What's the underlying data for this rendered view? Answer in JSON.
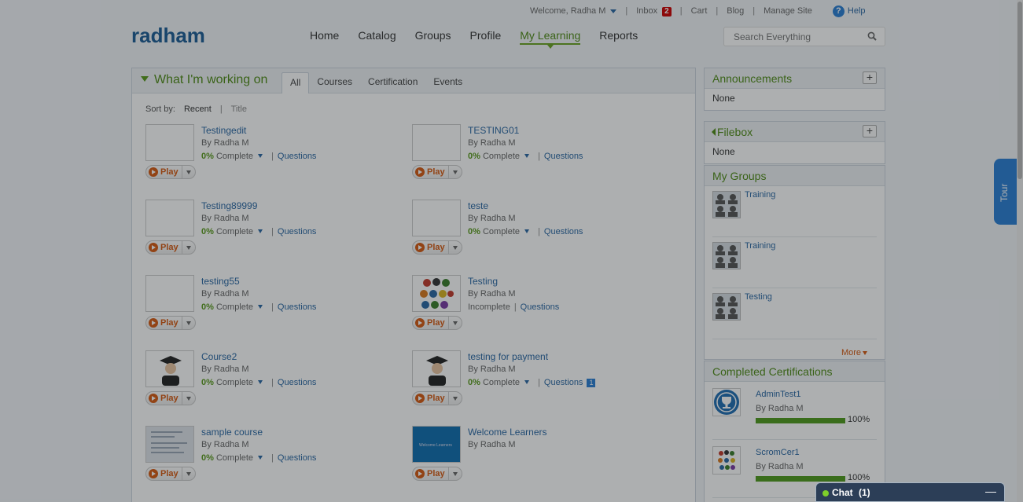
{
  "utilbar": {
    "welcome": "Welcome, Radha M",
    "inbox_label": "Inbox",
    "inbox_count": "2",
    "cart": "Cart",
    "blog": "Blog",
    "manage_site": "Manage Site",
    "help": "Help",
    "sep": "|"
  },
  "logo": "radham",
  "nav": {
    "home": "Home",
    "catalog": "Catalog",
    "groups": "Groups",
    "profile": "Profile",
    "my_learning": "My Learning",
    "reports": "Reports"
  },
  "search": {
    "placeholder": "Search Everything"
  },
  "working_on": {
    "title": "What I'm working on",
    "tabs": [
      "All",
      "Courses",
      "Certification",
      "Events"
    ],
    "active_tab": "All",
    "sort_label": "Sort by:",
    "sort_recent": "Recent",
    "sort_sep": "|",
    "sort_title": "Title"
  },
  "courses": [
    {
      "name": "Testingedit",
      "by": "By Radha M",
      "pct": "0%",
      "status": "Complete",
      "questions": "Questions",
      "play": "Play"
    },
    {
      "name": "TESTING01",
      "by": "By Radha M",
      "pct": "0%",
      "status": "Complete",
      "questions": "Questions",
      "play": "Play"
    },
    {
      "name": "Testing89999",
      "by": "By Radha M",
      "pct": "0%",
      "status": "Complete",
      "questions": "Questions",
      "play": "Play"
    },
    {
      "name": "teste",
      "by": "By Radha M",
      "pct": "0%",
      "status": "Complete",
      "questions": "Questions",
      "play": "Play"
    },
    {
      "name": "testing55",
      "by": "By Radha M",
      "pct": "0%",
      "status": "Complete",
      "questions": "Questions",
      "play": "Play"
    },
    {
      "name": "Testing",
      "by": "By Radha M",
      "pct": "",
      "status": "Incomplete",
      "questions": "Questions",
      "play": "Play"
    },
    {
      "name": "Course2",
      "by": "By Radha M",
      "pct": "0%",
      "status": "Complete",
      "questions": "Questions",
      "play": "Play"
    },
    {
      "name": "testing for payment",
      "by": "By Radha M",
      "pct": "0%",
      "status": "Complete",
      "questions": "Questions",
      "question_count": "1",
      "play": "Play"
    },
    {
      "name": "sample course",
      "by": "By Radha M",
      "pct": "0%",
      "status": "Complete",
      "questions": "Questions",
      "play": "Play"
    },
    {
      "name": "Welcome Learners",
      "by": "By Radha M",
      "play": "Play",
      "thumb_text": "Welcome Learners"
    }
  ],
  "announcements": {
    "title": "Announcements",
    "body": "None",
    "plus": "+"
  },
  "filebox": {
    "title": "Filebox",
    "body": "None",
    "plus": "+"
  },
  "my_groups": {
    "title": "My Groups",
    "items": [
      {
        "name": "Training"
      },
      {
        "name": "Training"
      },
      {
        "name": "Testing"
      }
    ],
    "more": "More"
  },
  "certifications": {
    "title": "Completed Certifications",
    "items": [
      {
        "name": "AdminTest1",
        "by": "By Radha M",
        "progress": 1.0,
        "value": "100%"
      },
      {
        "name": "ScromCer1",
        "by": "By Radha M",
        "progress": 1.0,
        "value": "100%"
      }
    ]
  },
  "tour": "Tour",
  "chat": {
    "label": "Chat",
    "count": "(1)",
    "minimize": "—"
  },
  "colors": {
    "accent_green": "#4f8b16",
    "link_blue": "#2a67a3",
    "play_orange": "#d65a12",
    "overlay": "rgba(20,25,30,0.35)"
  }
}
